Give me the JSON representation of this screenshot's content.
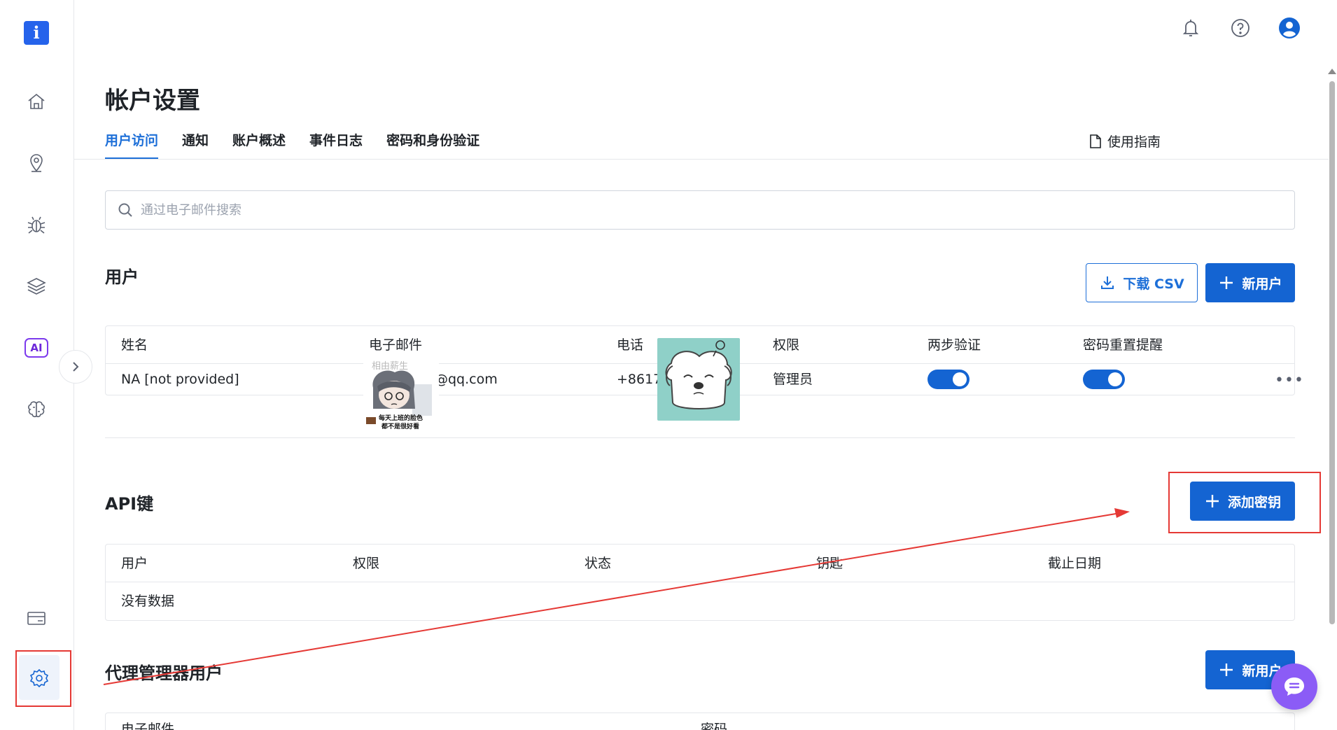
{
  "app": {
    "logo_letter": "i",
    "title": "帐户设置"
  },
  "sidebar": {
    "items": [
      {
        "icon": "home-icon"
      },
      {
        "icon": "location-pin-icon"
      },
      {
        "icon": "bug-icon"
      },
      {
        "icon": "layers-icon"
      },
      {
        "icon": "ai-icon",
        "label": "AI"
      },
      {
        "icon": "brain-icon"
      },
      {
        "icon": "billing-card-icon"
      },
      {
        "icon": "settings-gear-icon",
        "active": true
      }
    ]
  },
  "tabs": [
    {
      "label": "用户访问",
      "active": true
    },
    {
      "label": "通知"
    },
    {
      "label": "账户概述"
    },
    {
      "label": "事件日志"
    },
    {
      "label": "密码和身份验证"
    }
  ],
  "guide_link": "使用指南",
  "search": {
    "placeholder": "通过电子邮件搜索"
  },
  "users": {
    "title": "用户",
    "download_csv": "下载 CSV",
    "new_user": "新用户",
    "columns": [
      "姓名",
      "电子邮件",
      "电话",
      "权限",
      "两步验证",
      "密码重置提醒"
    ],
    "rows": [
      {
        "name": "NA [not provided]",
        "email": "@qq.com",
        "phone": "+8617",
        "role": "管理员",
        "two_factor": true,
        "password_reset": true
      }
    ]
  },
  "stickers": {
    "caption_top": "相由薪生",
    "caption_bottom_1": "每天上班的脸色",
    "caption_bottom_2": "都不是很好看"
  },
  "api_keys": {
    "title": "API键",
    "add_key": "添加密钥",
    "columns": [
      "用户",
      "权限",
      "状态",
      "钥匙",
      "截止日期"
    ],
    "empty": "没有数据"
  },
  "proxy": {
    "title": "代理管理器用户",
    "new_user": "新用户",
    "columns": [
      "电子邮件",
      "密码"
    ]
  },
  "colors": {
    "accent": "#1464d2",
    "annotation_red": "#e53935",
    "chat_fab": "#8b5cf6"
  }
}
